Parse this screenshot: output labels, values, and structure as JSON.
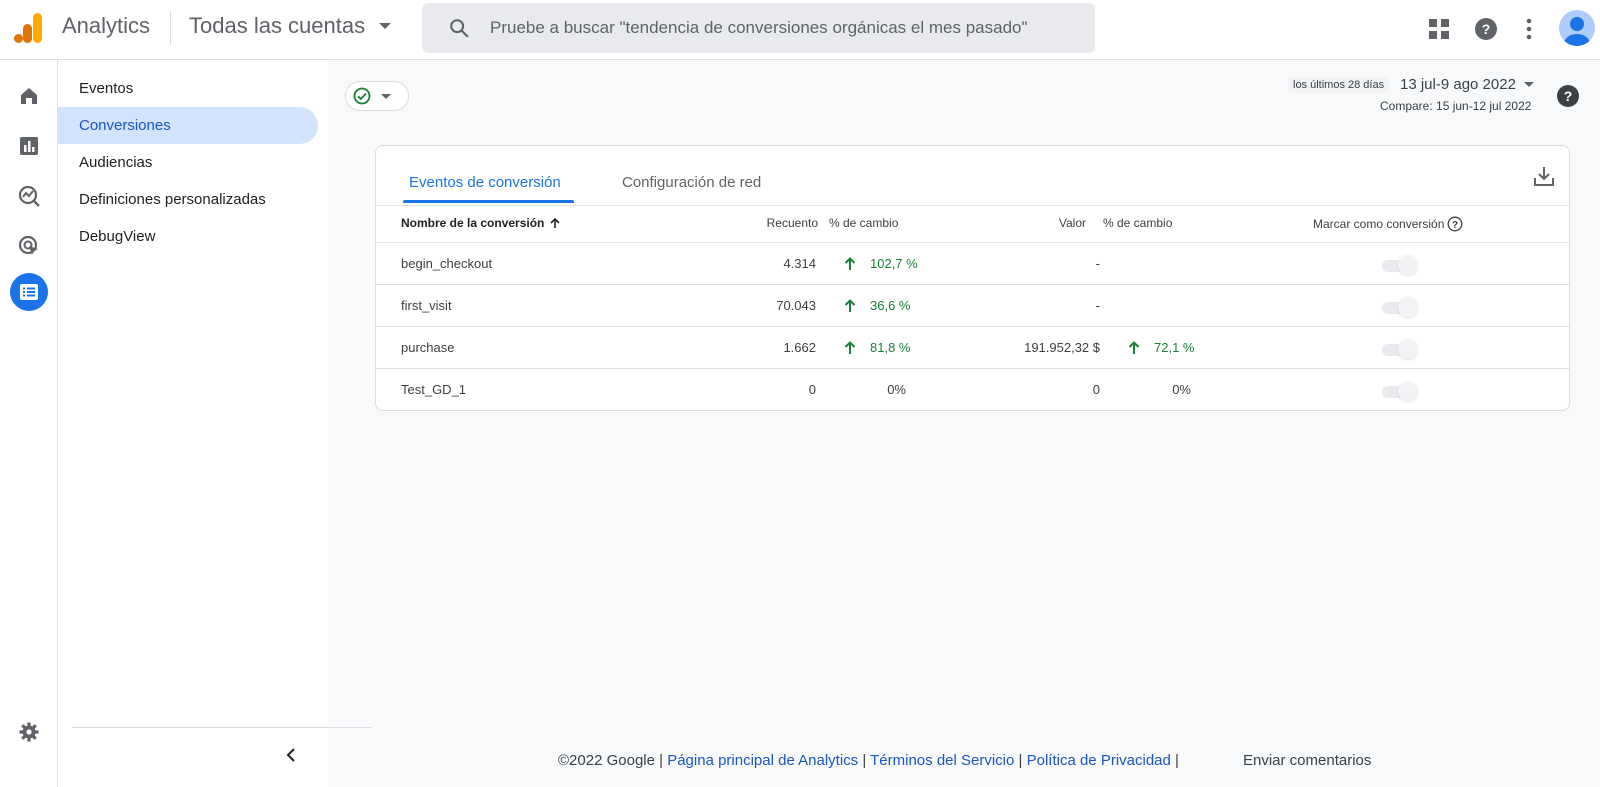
{
  "header": {
    "app_title": "Analytics",
    "account": "Todas las cuentas",
    "search_placeholder": "Pruebe a buscar \"tendencia de conversiones orgánicas el mes pasado\"",
    "icons": [
      "apps-grid-icon",
      "help-icon",
      "more-vert-icon",
      "avatar"
    ]
  },
  "rail": {
    "items": [
      "home-icon",
      "reports-icon",
      "explore-icon",
      "advertising-icon",
      "configure-icon"
    ],
    "active": "configure-icon",
    "settings_icon": "gear-icon"
  },
  "subnav": {
    "items": [
      {
        "label": "Eventos",
        "active": false
      },
      {
        "label": "Conversiones",
        "active": true
      },
      {
        "label": "Audiencias",
        "active": false
      },
      {
        "label": "Definiciones personalizadas",
        "active": false
      },
      {
        "label": "DebugView",
        "active": false
      }
    ]
  },
  "date": {
    "preset": "los últimos 28 días",
    "range": "13 jul-9 ago 2022",
    "compare": "Compare: 15 jun-12 jul 2022"
  },
  "card": {
    "tabs": [
      {
        "label": "Eventos de conversión",
        "active": true
      },
      {
        "label": "Configuración de red",
        "active": false
      }
    ],
    "columns": {
      "name": "Nombre de la conversión",
      "count": "Recuento",
      "count_change": "% de cambio",
      "value": "Valor",
      "value_change": "% de cambio",
      "mark": "Marcar como conversión"
    },
    "rows": [
      {
        "name": "begin_checkout",
        "count": "4.314",
        "count_change": "102,7 %",
        "count_up": true,
        "value": "-",
        "value_change": "",
        "value_up": false,
        "toggle": true
      },
      {
        "name": "first_visit",
        "count": "70.043",
        "count_change": "36,6 %",
        "count_up": true,
        "value": "-",
        "value_change": "",
        "value_up": false,
        "toggle": true
      },
      {
        "name": "purchase",
        "count": "1.662",
        "count_change": "81,8 %",
        "count_up": true,
        "value": "191.952,32 $",
        "value_change": "72,1 %",
        "value_up": true,
        "toggle": true
      },
      {
        "name": "Test_GD_1",
        "count": "0",
        "count_change": "0%",
        "count_up": false,
        "value": "0",
        "value_change": "0%",
        "value_up": false,
        "toggle": true
      }
    ]
  },
  "footer": {
    "copyright": "©2022 Google |",
    "link_home": "Página principal de Analytics",
    "sep1": "|",
    "link_terms": "Términos del Servicio",
    "sep2": "|",
    "link_privacy": "Política de Privacidad",
    "sep3": "|",
    "feedback": "Enviar comentarios"
  },
  "colors": {
    "accent": "#1a73e8",
    "positive": "#188038",
    "logo_orange": "#e37400",
    "logo_yellow": "#f9ab00"
  }
}
